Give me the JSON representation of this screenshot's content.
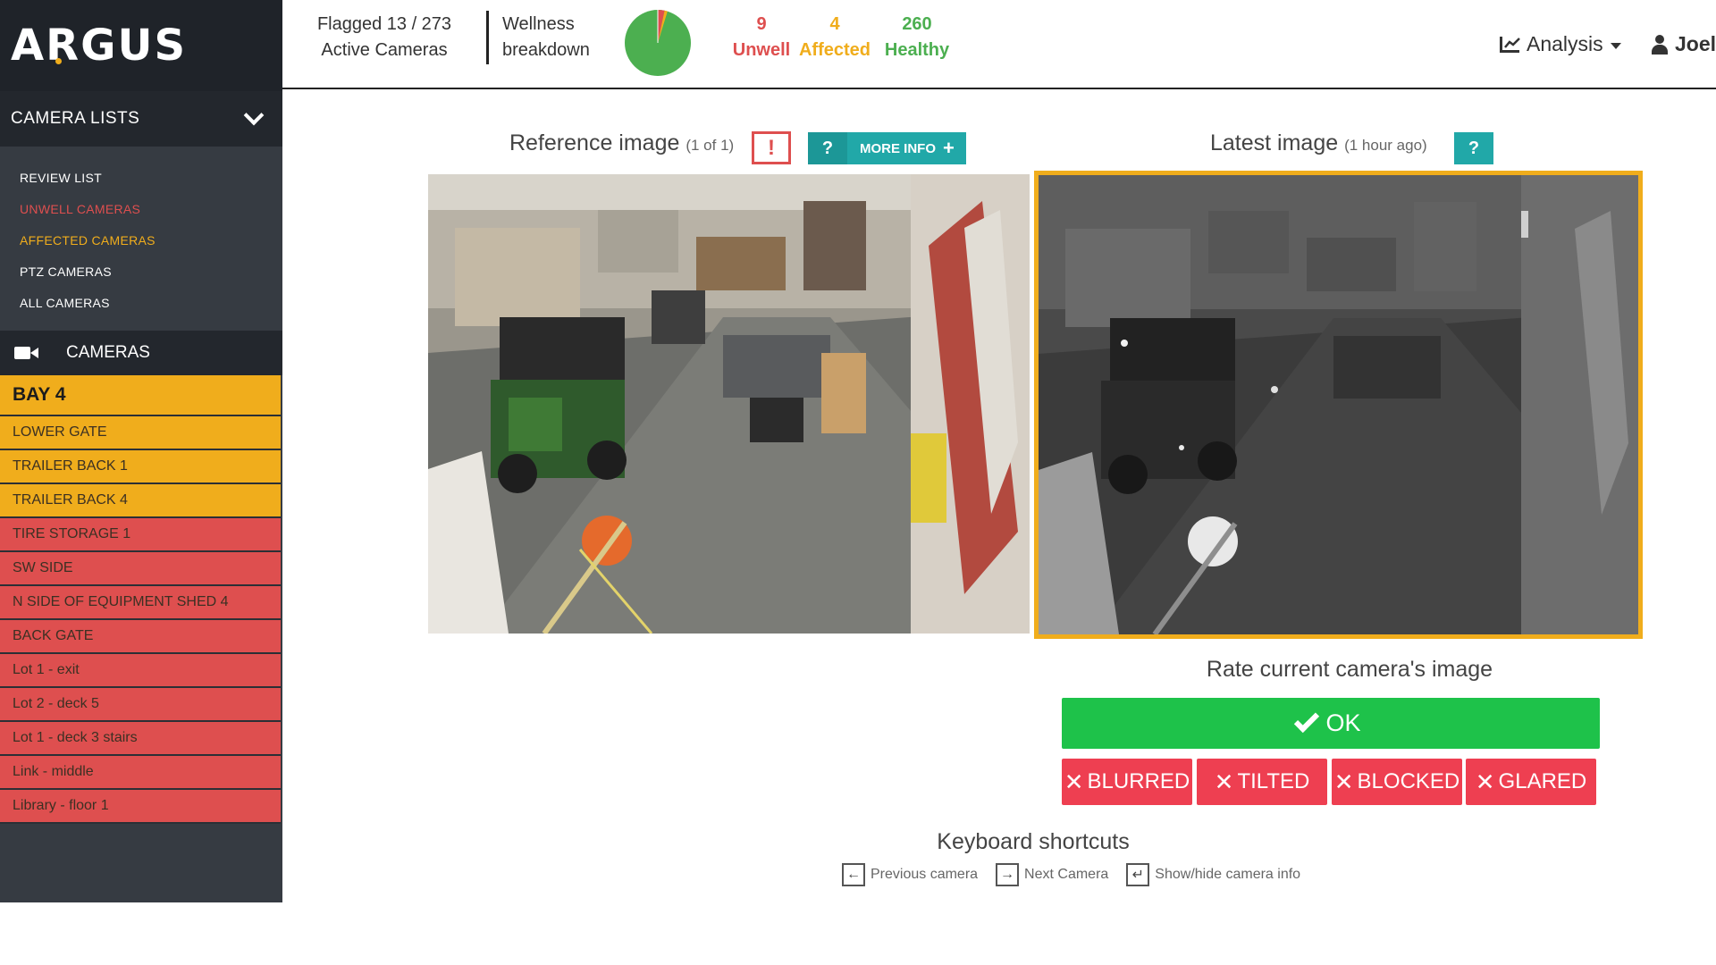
{
  "app": {
    "logo": "ARGUS"
  },
  "colors": {
    "unwell": "#de4f4f",
    "affected": "#f0ad1c",
    "healthy": "#4caf50",
    "accent": "#21a8a8",
    "ok": "#1ec24a",
    "fail": "#ee3f51"
  },
  "sidebar": {
    "lists_header": "CAMERA LISTS",
    "list_items": [
      {
        "label": "REVIEW LIST",
        "color": "#ffffff"
      },
      {
        "label": "UNWELL CAMERAS",
        "color": "#de4f4f"
      },
      {
        "label": "AFFECTED CAMERAS",
        "color": "#f0ad1c"
      },
      {
        "label": "PTZ CAMERAS",
        "color": "#ffffff"
      },
      {
        "label": "ALL CAMERAS",
        "color": "#ffffff"
      }
    ],
    "cameras_header": "CAMERAS",
    "cameras": [
      {
        "label": "BAY 4",
        "status": "orange"
      },
      {
        "label": "LOWER GATE",
        "status": "orange"
      },
      {
        "label": "TRAILER BACK 1",
        "status": "orange"
      },
      {
        "label": "TRAILER BACK 4",
        "status": "orange"
      },
      {
        "label": "TIRE STORAGE 1",
        "status": "red"
      },
      {
        "label": "SW SIDE",
        "status": "red"
      },
      {
        "label": "N SIDE OF EQUIPMENT SHED 4",
        "status": "red"
      },
      {
        "label": "BACK GATE",
        "status": "red"
      },
      {
        "label": "Lot 1 - exit",
        "status": "red"
      },
      {
        "label": "Lot 2 - deck 5",
        "status": "red"
      },
      {
        "label": "Lot 1 - deck 3 stairs",
        "status": "red"
      },
      {
        "label": "Link - middle",
        "status": "red"
      },
      {
        "label": "Library - floor 1",
        "status": "red"
      }
    ]
  },
  "topbar": {
    "flagged_line1": "Flagged 13 / 273",
    "flagged_line2": "Active Cameras",
    "wellness_line1": "Wellness",
    "wellness_line2": "breakdown",
    "unwell_count": "9",
    "unwell_label": "Unwell",
    "affected_count": "4",
    "affected_label": "Affected",
    "healthy_count": "260",
    "healthy_label": "Healthy",
    "analysis_label": "Analysis",
    "user_label": "Joel"
  },
  "reference": {
    "title": "Reference image",
    "subtitle": "(1 of 1)",
    "alert_label": "!",
    "help_label": "?",
    "more_info_label": "MORE INFO",
    "more_info_plus": "+"
  },
  "latest": {
    "title": "Latest image",
    "subtitle": "(1 hour ago)",
    "help_label": "?"
  },
  "rating": {
    "label": "Rate current camera's image",
    "ok": "OK",
    "x_glyph": "✕",
    "buttons": {
      "blurred": "BLURRED",
      "tilted": "TILTED",
      "blocked": "BLOCKED",
      "glared": "GLARED"
    }
  },
  "shortcuts": {
    "title": "Keyboard shortcuts",
    "previous": "Previous camera",
    "next": "Next Camera",
    "toggle_info": "Show/hide camera info"
  }
}
